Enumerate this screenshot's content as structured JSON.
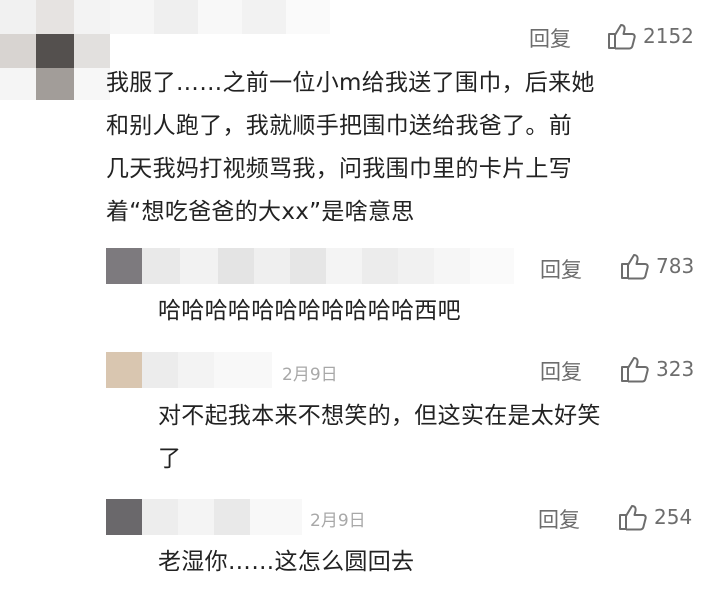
{
  "comments": [
    {
      "date": "",
      "reply_label": "回复",
      "likes": "2152",
      "lines": [
        "我服了……之前一位小m给我送了围巾，后来她",
        "和别人跑了，我就顺手把围巾送给我爸了。前",
        "几天我妈打视频骂我，问我围巾里的卡片上写",
        "着“想吃爸爸的大xx”是啥意思"
      ]
    },
    {
      "date": "",
      "reply_label": "回复",
      "likes": "783",
      "lines": [
        "哈哈哈哈哈哈哈哈哈哈哈西吧"
      ]
    },
    {
      "date": "2月9日",
      "reply_label": "回复",
      "likes": "323",
      "lines": [
        "对不起我本来不想笑的，但这实在是太好笑",
        "了"
      ]
    },
    {
      "date": "2月9日",
      "reply_label": "回复",
      "likes": "254",
      "lines": [
        "老湿你……这怎么圆回去"
      ]
    }
  ],
  "icons": {
    "like": "thumbs-up-icon"
  },
  "colors": {
    "meta": "#6d6d6d",
    "date": "#a8a8a8",
    "text": "#222222"
  }
}
